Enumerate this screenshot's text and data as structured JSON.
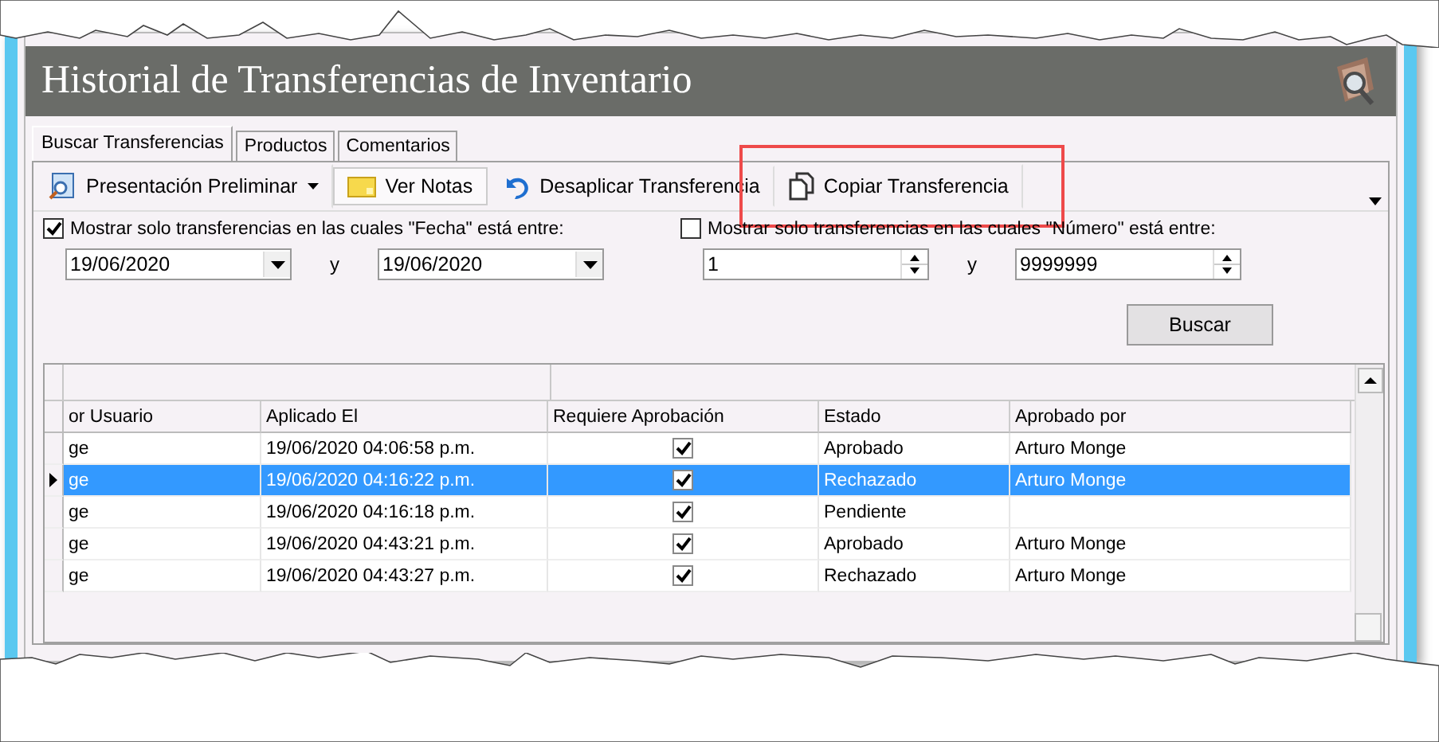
{
  "window": {
    "title": "Historial de Transferencias de Inventario"
  },
  "tabs": [
    {
      "label": "Buscar Transferencias",
      "selected": true
    },
    {
      "label": "Productos",
      "selected": false
    },
    {
      "label": "Comentarios",
      "selected": false
    }
  ],
  "toolbar": [
    {
      "label": "Presentación Preliminar",
      "has_menu": true,
      "pressed": false
    },
    {
      "label": "Ver Notas",
      "has_menu": false,
      "pressed": true
    },
    {
      "label": "Desaplicar Transferencia",
      "has_menu": false,
      "pressed": false
    },
    {
      "label": "Copiar Transferencia",
      "has_menu": false,
      "pressed": false,
      "highlighted": true
    }
  ],
  "filters": [
    {
      "label": "Mostrar solo transferencias en las cuales \"Fecha\" está entre:",
      "checked": true,
      "kind": "date",
      "from": "19/06/2020",
      "separator": "y",
      "to": "19/06/2020"
    },
    {
      "label": "Mostrar solo transferencias en las cuales \"Número\" está entre:",
      "checked": false,
      "kind": "number",
      "from": "1",
      "separator": "y",
      "to": "9999999"
    }
  ],
  "search_button": "Buscar",
  "table": {
    "columns": [
      "or Usuario",
      "Aplicado El",
      "Requiere Aprobación",
      "Estado",
      "Aprobado por"
    ],
    "rows": [
      {
        "selected": false,
        "column_1": "ge",
        "applied": "19/06/2020 04:06:58 p.m.",
        "requires_approval": true,
        "status": "Aprobado",
        "approved_by": "Arturo Monge"
      },
      {
        "selected": true,
        "column_1": "ge",
        "applied": "19/06/2020 04:16:22 p.m.",
        "requires_approval": true,
        "status": "Rechazado",
        "approved_by": "Arturo Monge"
      },
      {
        "selected": false,
        "column_1": "ge",
        "applied": "19/06/2020 04:16:18 p.m.",
        "requires_approval": true,
        "status": "Pendiente"
      },
      {
        "selected": false,
        "column_1": "ge",
        "applied": "19/06/2020 04:43:21 p.m.",
        "requires_approval": true,
        "status": "Aprobado",
        "approved_by": "Arturo Monge"
      },
      {
        "selected": false,
        "column_1": "ge",
        "applied": "19/06/2020 04:43:27 p.m.",
        "requires_approval": true,
        "status": "Rechazado",
        "approved_by": "Arturo Monge"
      }
    ]
  }
}
